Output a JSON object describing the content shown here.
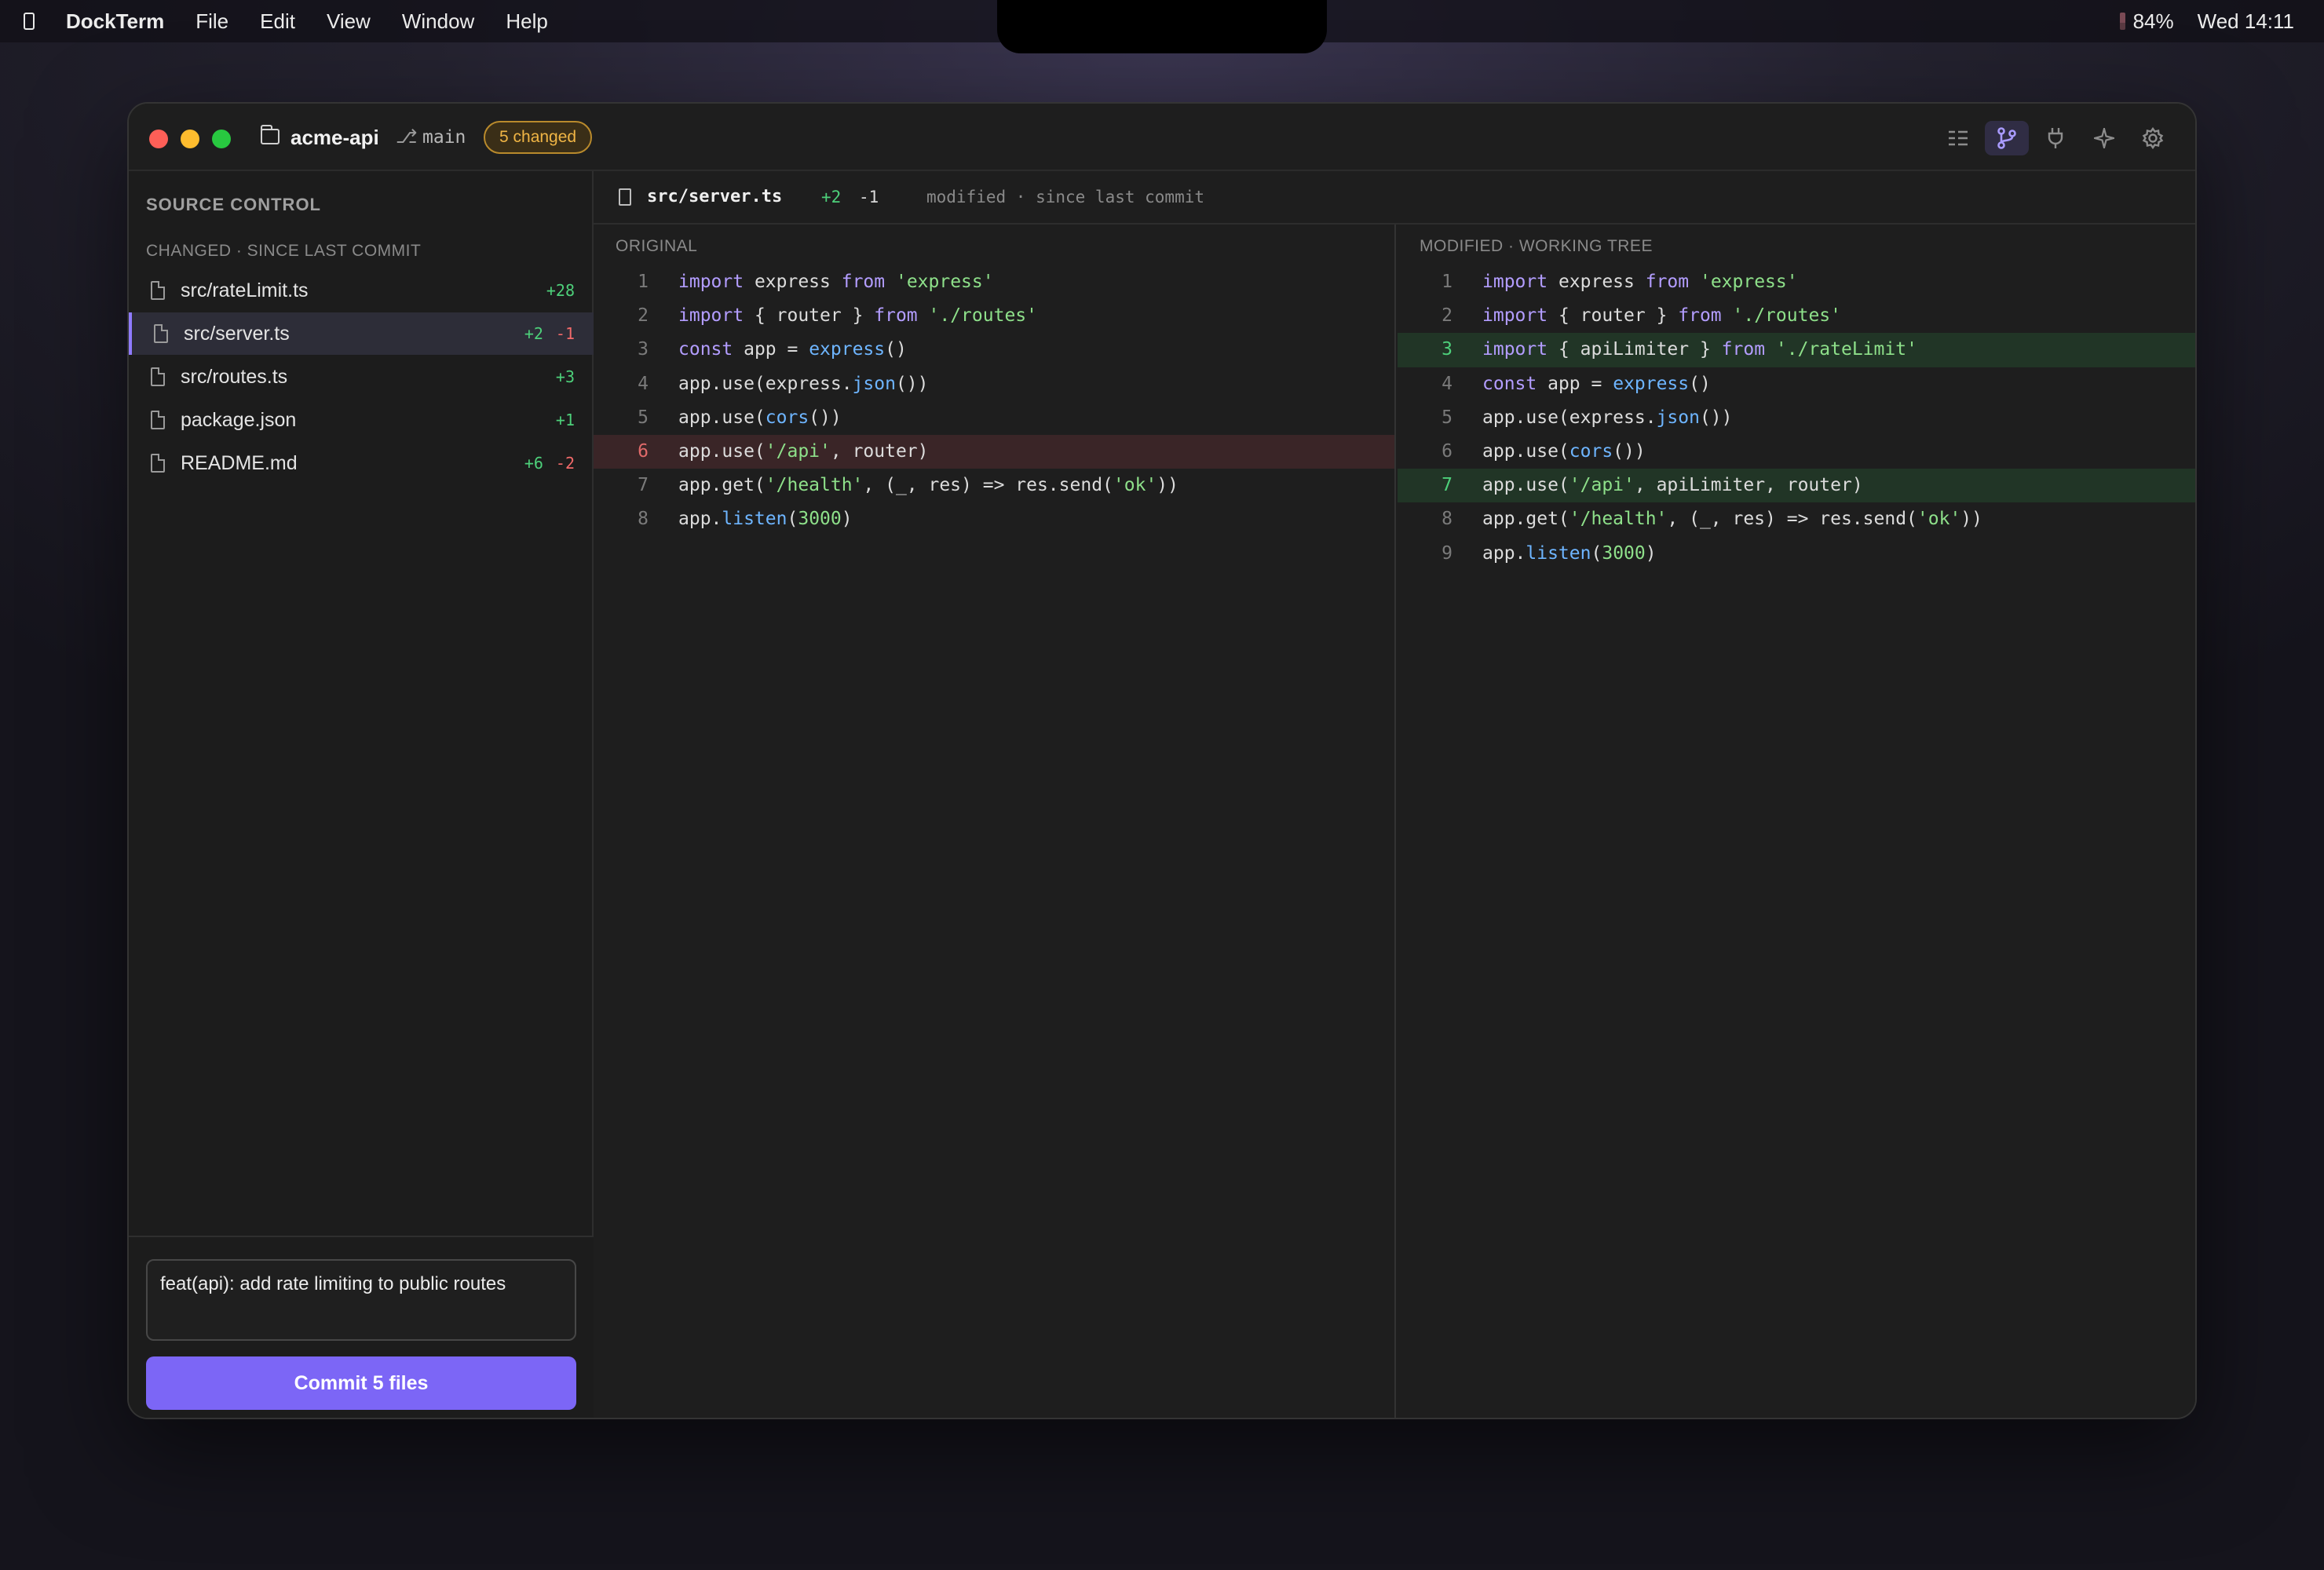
{
  "menubar": {
    "app_name": "DockTerm",
    "menus": [
      "File",
      "Edit",
      "View",
      "Window",
      "Help"
    ],
    "battery": "84%",
    "clock": "Wed 14:11"
  },
  "titlebar": {
    "project": "acme-api",
    "branch": "main",
    "changed_badge": "5 changed",
    "tools": [
      "list-icon",
      "branch-icon",
      "plug-icon",
      "sparkle-icon",
      "gear-icon"
    ],
    "active_tool": "branch-icon"
  },
  "sidebar": {
    "title": "SOURCE CONTROL",
    "section": "CHANGED · SINCE LAST COMMIT",
    "files": [
      {
        "name": "src/rateLimit.ts",
        "add": "+28",
        "del": ""
      },
      {
        "name": "src/server.ts",
        "add": "+2",
        "del": "-1",
        "selected": true
      },
      {
        "name": "src/routes.ts",
        "add": "+3",
        "del": ""
      },
      {
        "name": "package.json",
        "add": "+1",
        "del": ""
      },
      {
        "name": "README.md",
        "add": "+6",
        "del": "-2"
      }
    ],
    "commit_message": "feat(api): add rate limiting to public routes",
    "commit_button": "Commit 5 files"
  },
  "diff": {
    "path": "src/server.ts",
    "add": "+2",
    "del": "-1",
    "status": "modified · since last commit",
    "original_label": "ORIGINAL",
    "modified_label": "MODIFIED · WORKING TREE",
    "original_lines": [
      {
        "n": "1",
        "code": "import express from 'express'"
      },
      {
        "n": "2",
        "code": "import { router } from './routes'"
      },
      {
        "n": "3",
        "code": "const app = express()"
      },
      {
        "n": "4",
        "code": "app.use(express.json())"
      },
      {
        "n": "5",
        "code": "app.use(cors())"
      },
      {
        "n": "6",
        "code": "app.use('/api', router)",
        "type": "removed"
      },
      {
        "n": "7",
        "code": "app.get('/health', (_, res) => res.send('ok'))"
      },
      {
        "n": "8",
        "code": "app.listen(3000)"
      }
    ],
    "modified_lines": [
      {
        "n": "1",
        "code": "import express from 'express'"
      },
      {
        "n": "2",
        "code": "import { router } from './routes'"
      },
      {
        "n": "3",
        "code": "import { apiLimiter } from './rateLimit'",
        "type": "added"
      },
      {
        "n": "4",
        "code": "const app = express()"
      },
      {
        "n": "5",
        "code": "app.use(express.json())"
      },
      {
        "n": "6",
        "code": "app.use(cors())"
      },
      {
        "n": "7",
        "code": "app.use('/api', apiLimiter, router)",
        "type": "added"
      },
      {
        "n": "8",
        "code": "app.get('/health', (_, res) => res.send('ok'))"
      },
      {
        "n": "9",
        "code": "app.listen(3000)"
      }
    ]
  }
}
